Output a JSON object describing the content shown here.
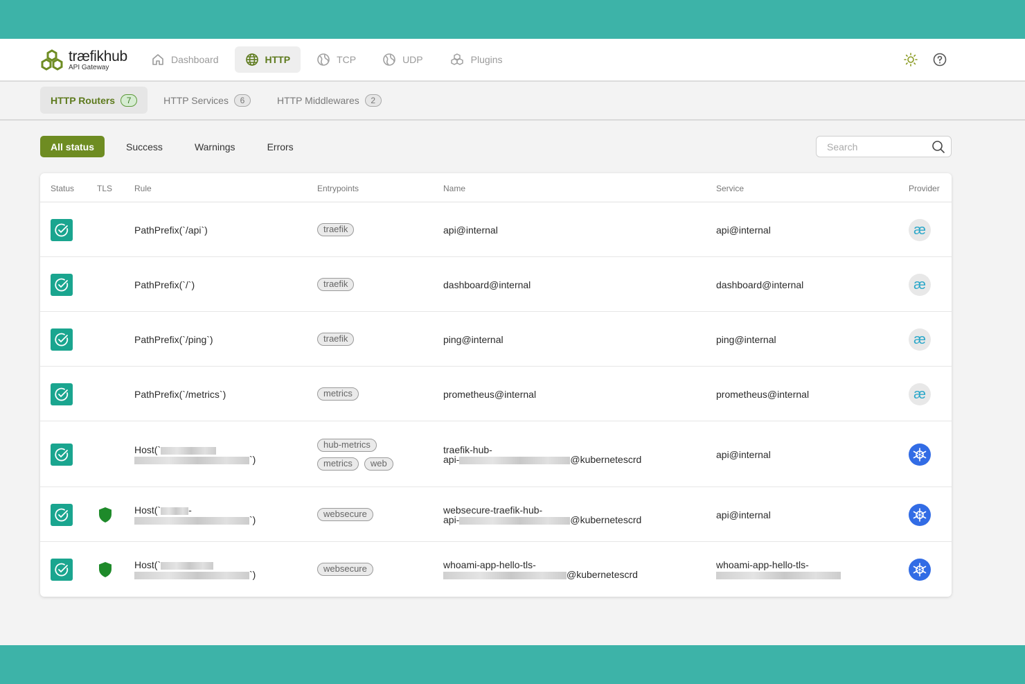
{
  "brand": {
    "name_prefix": "træfik",
    "name_suffix": "hub",
    "subtitle": "API Gateway"
  },
  "nav": {
    "tabs": [
      {
        "label": "Dashboard",
        "icon": "home-icon",
        "active": false
      },
      {
        "label": "HTTP",
        "icon": "globe-icon",
        "active": true
      },
      {
        "label": "TCP",
        "icon": "network-icon",
        "active": false
      },
      {
        "label": "UDP",
        "icon": "network-icon",
        "active": false
      },
      {
        "label": "Plugins",
        "icon": "plugins-icon",
        "active": false
      }
    ],
    "right_icons": [
      "theme-sun-icon",
      "help-icon"
    ]
  },
  "subtabs": [
    {
      "label": "HTTP Routers",
      "count": "7",
      "active": true
    },
    {
      "label": "HTTP Services",
      "count": "6",
      "active": false
    },
    {
      "label": "HTTP Middlewares",
      "count": "2",
      "active": false
    }
  ],
  "filters": [
    {
      "label": "All status",
      "active": true
    },
    {
      "label": "Success",
      "active": false
    },
    {
      "label": "Warnings",
      "active": false
    },
    {
      "label": "Errors",
      "active": false
    }
  ],
  "search": {
    "placeholder": "Search",
    "value": ""
  },
  "table": {
    "headers": {
      "status": "Status",
      "tls": "TLS",
      "rule": "Rule",
      "entrypoints": "Entrypoints",
      "name": "Name",
      "service": "Service",
      "provider": "Provider"
    },
    "rows": [
      {
        "status": "success",
        "tls": false,
        "rule": "PathPrefix(`/api`)",
        "entrypoints": [
          "traefik"
        ],
        "name": "api@internal",
        "service": "api@internal",
        "provider": "internal"
      },
      {
        "status": "success",
        "tls": false,
        "rule": "PathPrefix(`/`)",
        "entrypoints": [
          "traefik"
        ],
        "name": "dashboard@internal",
        "service": "dashboard@internal",
        "provider": "internal"
      },
      {
        "status": "success",
        "tls": false,
        "rule": "PathPrefix(`/ping`)",
        "entrypoints": [
          "traefik"
        ],
        "name": "ping@internal",
        "service": "ping@internal",
        "provider": "internal"
      },
      {
        "status": "success",
        "tls": false,
        "rule": "PathPrefix(`/metrics`)",
        "entrypoints": [
          "metrics"
        ],
        "name": "prometheus@internal",
        "service": "prometheus@internal",
        "provider": "internal"
      },
      {
        "status": "success",
        "tls": false,
        "rule_start": "Host(`",
        "rule_end": "`)",
        "entrypoints": [
          "hub-metrics",
          "metrics",
          "web"
        ],
        "name_l1": "traefik-hub-",
        "name_l2": "api-",
        "name_suffix": "@kubernetescrd",
        "service": "api@internal",
        "provider": "kubernetes"
      },
      {
        "status": "success",
        "tls": true,
        "rule_start": "Host(`",
        "rule_mid": "-",
        "rule_end": "`)",
        "entrypoints": [
          "websecure"
        ],
        "name_l1": "websecure-traefik-hub-",
        "name_l2": "api-",
        "name_suffix": "@kubernetescrd",
        "service": "api@internal",
        "provider": "kubernetes"
      },
      {
        "status": "success",
        "tls": true,
        "rule_start": "Host(`",
        "rule_end": "`)",
        "entrypoints": [
          "websecure"
        ],
        "name_l1": "whoami-app-hello-tls-",
        "name_suffix": "@kubernetescrd",
        "service_l1": "whoami-app-hello-tls-",
        "provider": "kubernetes"
      }
    ]
  },
  "colors": {
    "accent": "#6e8c22",
    "success": "#1aa58f",
    "tls": "#1e8a2a",
    "kubernetes": "#326ce5",
    "frame": "#3db3a8"
  }
}
